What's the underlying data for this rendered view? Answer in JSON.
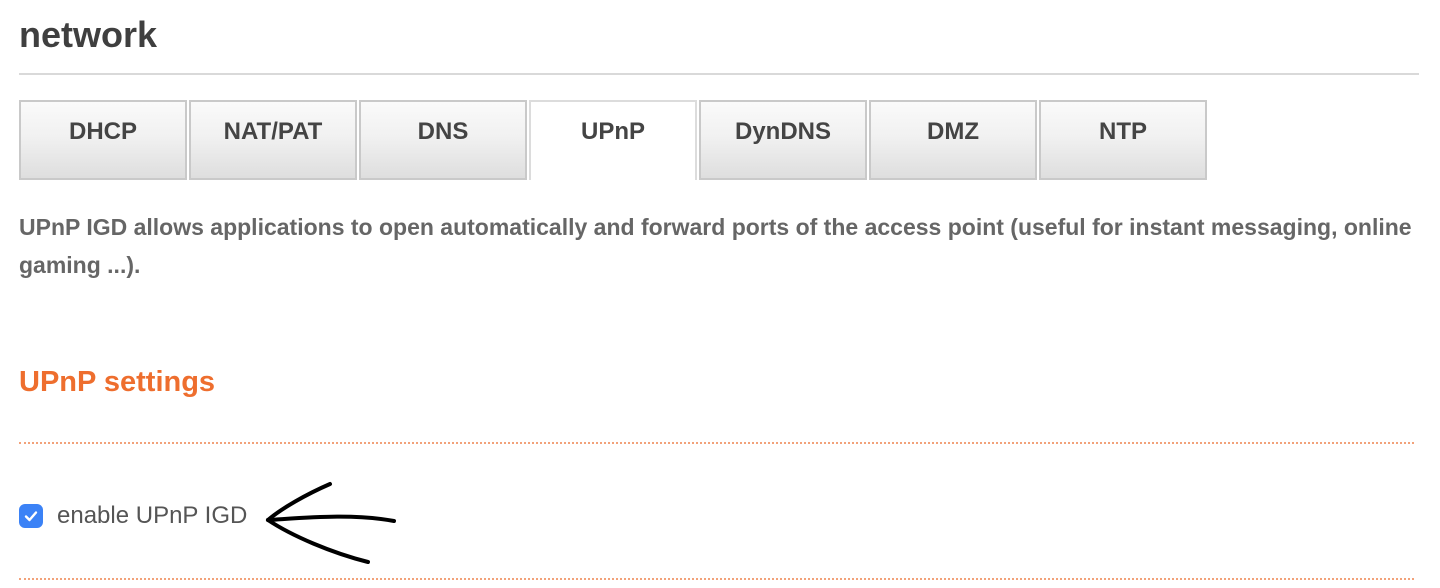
{
  "header": {
    "title": "network"
  },
  "tabs": [
    {
      "label": "DHCP",
      "active": false
    },
    {
      "label": "NAT/PAT",
      "active": false
    },
    {
      "label": "DNS",
      "active": false
    },
    {
      "label": "UPnP",
      "active": true
    },
    {
      "label": "DynDNS",
      "active": false
    },
    {
      "label": "DMZ",
      "active": false
    },
    {
      "label": "NTP",
      "active": false
    }
  ],
  "content": {
    "description": "UPnP IGD allows applications to open automatically and forward ports of the access point (useful for instant messaging, online gaming ...).",
    "section_title": "UPnP settings",
    "upnp_checkbox": {
      "label": "enable UPnP IGD",
      "checked": true
    }
  },
  "colors": {
    "accent_orange": "#ee6e2e",
    "checkbox_blue": "#3b82f6",
    "title_text": "#3f3f3f",
    "body_text": "#666666"
  },
  "icons": {
    "checkbox": "checkmark-icon",
    "annotation": "hand-drawn-arrow-icon"
  }
}
